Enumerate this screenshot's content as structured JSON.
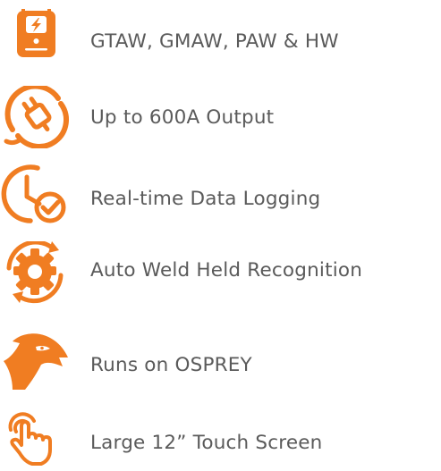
{
  "colors": {
    "accent": "#f07d22",
    "text": "#5a5a5a"
  },
  "features": [
    {
      "label": "GTAW, GMAW, PAW & HW",
      "icon": "welding-machine-icon"
    },
    {
      "label": "Up to 600A Output",
      "icon": "power-plug-icon"
    },
    {
      "label": "Real-time Data Logging",
      "icon": "clock-check-icon"
    },
    {
      "label": "Auto Weld Held Recognition",
      "icon": "gear-refresh-icon"
    },
    {
      "label": "Runs on OSPREY",
      "icon": "osprey-head-icon"
    },
    {
      "label": "Large 12” Touch Screen",
      "icon": "touch-hand-icon"
    }
  ]
}
